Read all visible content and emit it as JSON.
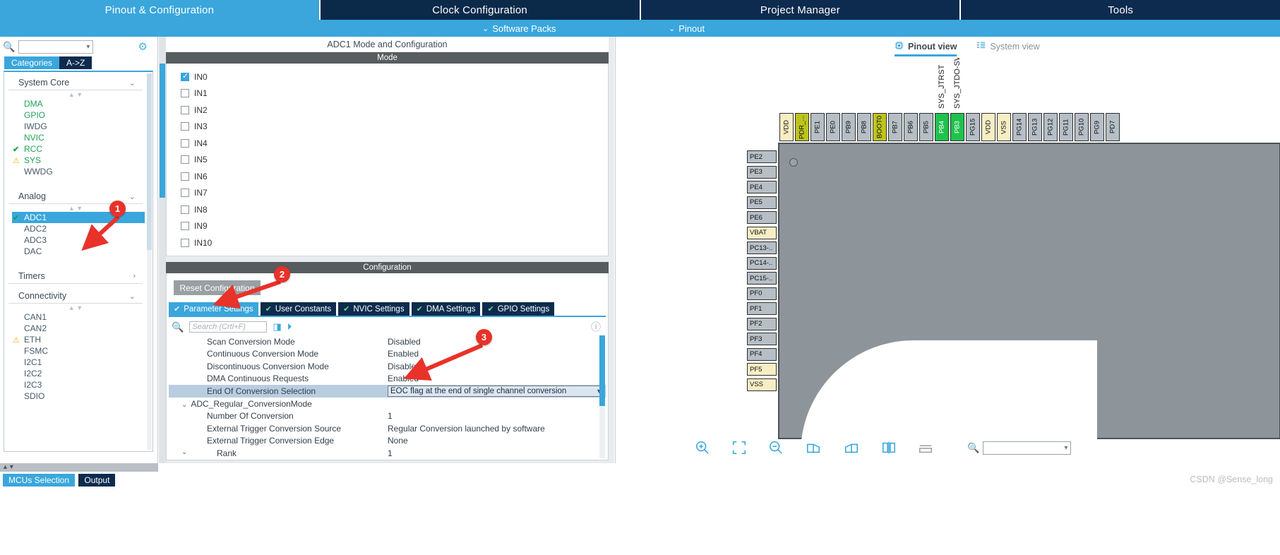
{
  "main_tabs": [
    {
      "label": "Pinout & Configuration",
      "active": true
    },
    {
      "label": "Clock Configuration",
      "active": false
    },
    {
      "label": "Project Manager",
      "active": false
    },
    {
      "label": "Tools",
      "active": false
    }
  ],
  "second_bar": {
    "software_packs": "Software Packs",
    "pinout": "Pinout",
    "chevron": "⌄"
  },
  "left_panel": {
    "search_value": "",
    "gear_icon": "gear-icon",
    "cat_tabs": [
      {
        "label": "Categories",
        "active": true
      },
      {
        "label": "A->Z",
        "active": false
      }
    ],
    "groups": [
      {
        "name": "System Core",
        "chevron": "⌄",
        "items": [
          {
            "label": "DMA",
            "state": "green",
            "icon": ""
          },
          {
            "label": "GPIO",
            "state": "green",
            "icon": ""
          },
          {
            "label": "IWDG",
            "state": "plain",
            "icon": ""
          },
          {
            "label": "NVIC",
            "state": "green",
            "icon": ""
          },
          {
            "label": "RCC",
            "state": "green",
            "icon": "check"
          },
          {
            "label": "SYS",
            "state": "green",
            "icon": "warn"
          },
          {
            "label": "WWDG",
            "state": "plain",
            "icon": ""
          }
        ]
      },
      {
        "name": "Analog",
        "chevron": "⌄",
        "items": [
          {
            "label": "ADC1",
            "state": "selected",
            "icon": "check"
          },
          {
            "label": "ADC2",
            "state": "plain",
            "icon": ""
          },
          {
            "label": "ADC3",
            "state": "plain",
            "icon": ""
          },
          {
            "label": "DAC",
            "state": "plain",
            "icon": ""
          }
        ]
      },
      {
        "name": "Timers",
        "chevron": "›",
        "items": []
      },
      {
        "name": "Connectivity",
        "chevron": "⌄",
        "items": [
          {
            "label": "CAN1",
            "state": "plain",
            "icon": ""
          },
          {
            "label": "CAN2",
            "state": "plain",
            "icon": ""
          },
          {
            "label": "ETH",
            "state": "plain",
            "icon": "warn"
          },
          {
            "label": "FSMC",
            "state": "plain",
            "icon": ""
          },
          {
            "label": "I2C1",
            "state": "plain",
            "icon": ""
          },
          {
            "label": "I2C2",
            "state": "plain",
            "icon": ""
          },
          {
            "label": "I2C3",
            "state": "plain",
            "icon": ""
          },
          {
            "label": "SDIO",
            "state": "plain",
            "icon": ""
          }
        ]
      }
    ]
  },
  "center": {
    "panel_title": "ADC1 Mode and Configuration",
    "mode_header": "Mode",
    "channels": [
      {
        "label": "IN0",
        "checked": true
      },
      {
        "label": "IN1",
        "checked": false
      },
      {
        "label": "IN2",
        "checked": false
      },
      {
        "label": "IN3",
        "checked": false
      },
      {
        "label": "IN4",
        "checked": false
      },
      {
        "label": "IN5",
        "checked": false
      },
      {
        "label": "IN6",
        "checked": false
      },
      {
        "label": "IN7",
        "checked": false
      },
      {
        "label": "IN8",
        "checked": false
      },
      {
        "label": "IN9",
        "checked": false
      },
      {
        "label": "IN10",
        "checked": false
      }
    ],
    "config_header": "Configuration",
    "reset_button": "Reset Configuration",
    "config_tabs": [
      {
        "label": "Parameter Settings",
        "active": true
      },
      {
        "label": "User Constants",
        "active": false
      },
      {
        "label": "NVIC Settings",
        "active": false
      },
      {
        "label": "DMA Settings",
        "active": false
      },
      {
        "label": "GPIO Settings",
        "active": false
      }
    ],
    "param_search_placeholder": "Search (Crtl+F)",
    "nav_prev_icon": "circle-left-icon",
    "nav_next_icon": "circle-right-icon",
    "info_icon": "info-icon",
    "parameters": [
      {
        "key": "Scan Conversion Mode",
        "value": "Disabled",
        "kind": "item"
      },
      {
        "key": "Continuous Conversion Mode",
        "value": "Enabled",
        "kind": "item"
      },
      {
        "key": "Discontinuous Conversion Mode",
        "value": "Disabled",
        "kind": "item"
      },
      {
        "key": "DMA Continuous Requests",
        "value": "Enabled",
        "kind": "item"
      },
      {
        "key": "End Of Conversion Selection",
        "value": "EOC flag at the end of single channel conversion",
        "kind": "combo",
        "selected": true
      },
      {
        "key": "ADC_Regular_ConversionMode",
        "value": "",
        "kind": "group"
      },
      {
        "key": "Number Of Conversion",
        "value": "1",
        "kind": "item"
      },
      {
        "key": "External Trigger Conversion Source",
        "value": "Regular Conversion launched by software",
        "kind": "item"
      },
      {
        "key": "External Trigger Conversion Edge",
        "value": "None",
        "kind": "item"
      },
      {
        "key": "Rank",
        "value": "1",
        "kind": "subgroup"
      }
    ]
  },
  "right_panel": {
    "view_tabs": [
      {
        "label": "Pinout view",
        "icon": "chip-icon",
        "active": true
      },
      {
        "label": "System view",
        "icon": "list-icon",
        "active": false
      }
    ],
    "top_pins": [
      {
        "label": "VDD",
        "color": "yellowish"
      },
      {
        "label": "PDR_...",
        "color": "olive"
      },
      {
        "label": "PE1",
        "color": "gray"
      },
      {
        "label": "PE0",
        "color": "gray"
      },
      {
        "label": "PB9",
        "color": "gray"
      },
      {
        "label": "PB8",
        "color": "gray"
      },
      {
        "label": "BOOT0",
        "color": "olive"
      },
      {
        "label": "PB7",
        "color": "gray"
      },
      {
        "label": "PB6",
        "color": "gray"
      },
      {
        "label": "PB5",
        "color": "gray"
      },
      {
        "label": "PB4",
        "color": "green"
      },
      {
        "label": "PB3",
        "color": "green"
      },
      {
        "label": "PG15",
        "color": "gray"
      },
      {
        "label": "VDD",
        "color": "yellowish"
      },
      {
        "label": "VSS",
        "color": "yellowish"
      },
      {
        "label": "PG14",
        "color": "gray"
      },
      {
        "label": "PG13",
        "color": "gray"
      },
      {
        "label": "PG12",
        "color": "gray"
      },
      {
        "label": "PG11",
        "color": "gray"
      },
      {
        "label": "PG10",
        "color": "gray"
      },
      {
        "label": "PG9",
        "color": "gray"
      },
      {
        "label": "PD7",
        "color": "gray"
      }
    ],
    "top_signal_labels": [
      {
        "label": "SYS_JTRST",
        "pin_index": 10
      },
      {
        "label": "SYS_JTDO-SWO",
        "pin_index": 11
      }
    ],
    "left_pins": [
      {
        "label": "PE2",
        "color": "gray"
      },
      {
        "label": "PE3",
        "color": "gray"
      },
      {
        "label": "PE4",
        "color": "gray"
      },
      {
        "label": "PE5",
        "color": "gray"
      },
      {
        "label": "PE6",
        "color": "gray"
      },
      {
        "label": "VBAT",
        "color": "yellowish"
      },
      {
        "label": "PC13-..",
        "color": "gray"
      },
      {
        "label": "PC14-..",
        "color": "gray"
      },
      {
        "label": "PC15-..",
        "color": "gray"
      },
      {
        "label": "PF0",
        "color": "gray"
      },
      {
        "label": "PF1",
        "color": "gray"
      },
      {
        "label": "PF2",
        "color": "gray"
      },
      {
        "label": "PF3",
        "color": "gray"
      },
      {
        "label": "PF4",
        "color": "gray"
      },
      {
        "label": "PF5",
        "color": "yellowish"
      },
      {
        "label": "VSS",
        "color": "yellowish"
      }
    ],
    "zoom_tools": [
      {
        "icon": "zoom-in-icon"
      },
      {
        "icon": "fit-screen-icon"
      },
      {
        "icon": "zoom-out-icon"
      },
      {
        "icon": "rotate-left-icon"
      },
      {
        "icon": "rotate-right-icon"
      },
      {
        "icon": "flip-horizontal-icon"
      },
      {
        "icon": "flip-vertical-icon"
      }
    ],
    "pin_search_value": ""
  },
  "bottom": {
    "tabs": [
      {
        "label": "MCUs Selection",
        "active": true
      },
      {
        "label": "Output",
        "active": false
      }
    ],
    "watermark": "CSDN @Sense_long"
  },
  "annotations": [
    {
      "number": "1",
      "target": "ADC1 sidebar item"
    },
    {
      "number": "2",
      "target": "Parameter Settings tab"
    },
    {
      "number": "3",
      "target": "DMA Continuous Requests value"
    }
  ],
  "colors": {
    "accent": "#3aa6dc",
    "dark_navy": "#0d2b4e",
    "annotation_red": "#e8322a",
    "selected_row": "#b9cde0"
  }
}
